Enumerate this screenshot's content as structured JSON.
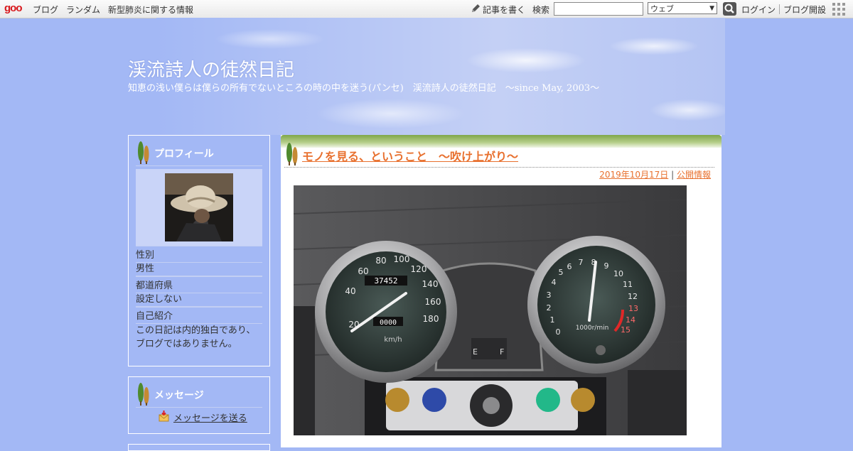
{
  "topbar": {
    "logo": "goo",
    "nav": [
      "ブログ",
      "ランダム",
      "新型肺炎に関する情報"
    ],
    "write_label": "記事を書く",
    "search_label": "検索",
    "search_value": "",
    "scope_selected": "ウェブ",
    "login_label": "ログイン",
    "open_blog_label": "ブログ開設"
  },
  "header": {
    "title": "渓流詩人の徒然日記",
    "description": "知恵の浅い僕らは僕らの所有でないところの時の中を迷う(パンセ)　渓流詩人の徒然日記　～since May, 2003～"
  },
  "profile": {
    "heading": "プロフィール",
    "gender_label": "性別",
    "gender_value": "男性",
    "pref_label": "都道府県",
    "pref_value": "設定しない",
    "intro_label": "自己紹介",
    "intro_value": "この日記は内的独白であり、ブログではありません。"
  },
  "message": {
    "heading": "メッセージ",
    "link": "メッセージを送る"
  },
  "post": {
    "title": "モノを見る、ということ　〜吹け上がり〜",
    "date": "2019年10月17日",
    "separator": "|",
    "category": "公開情報"
  },
  "photo": {
    "odometer": "37452",
    "trip": "0000",
    "speed_unit": "km/h",
    "tacho_unit": "1000r/min",
    "speed_ticks": [
      "20",
      "40",
      "60",
      "80",
      "100",
      "120",
      "140",
      "160",
      "180"
    ],
    "tacho_ticks": [
      "0",
      "1",
      "2",
      "3",
      "4",
      "5",
      "6",
      "7",
      "8",
      "9",
      "10",
      "11",
      "12",
      "13",
      "14",
      "15"
    ]
  },
  "colors": {
    "background": "#a3b8f5",
    "accent": "#e8702e",
    "topbar_logo": "#d8181c"
  }
}
